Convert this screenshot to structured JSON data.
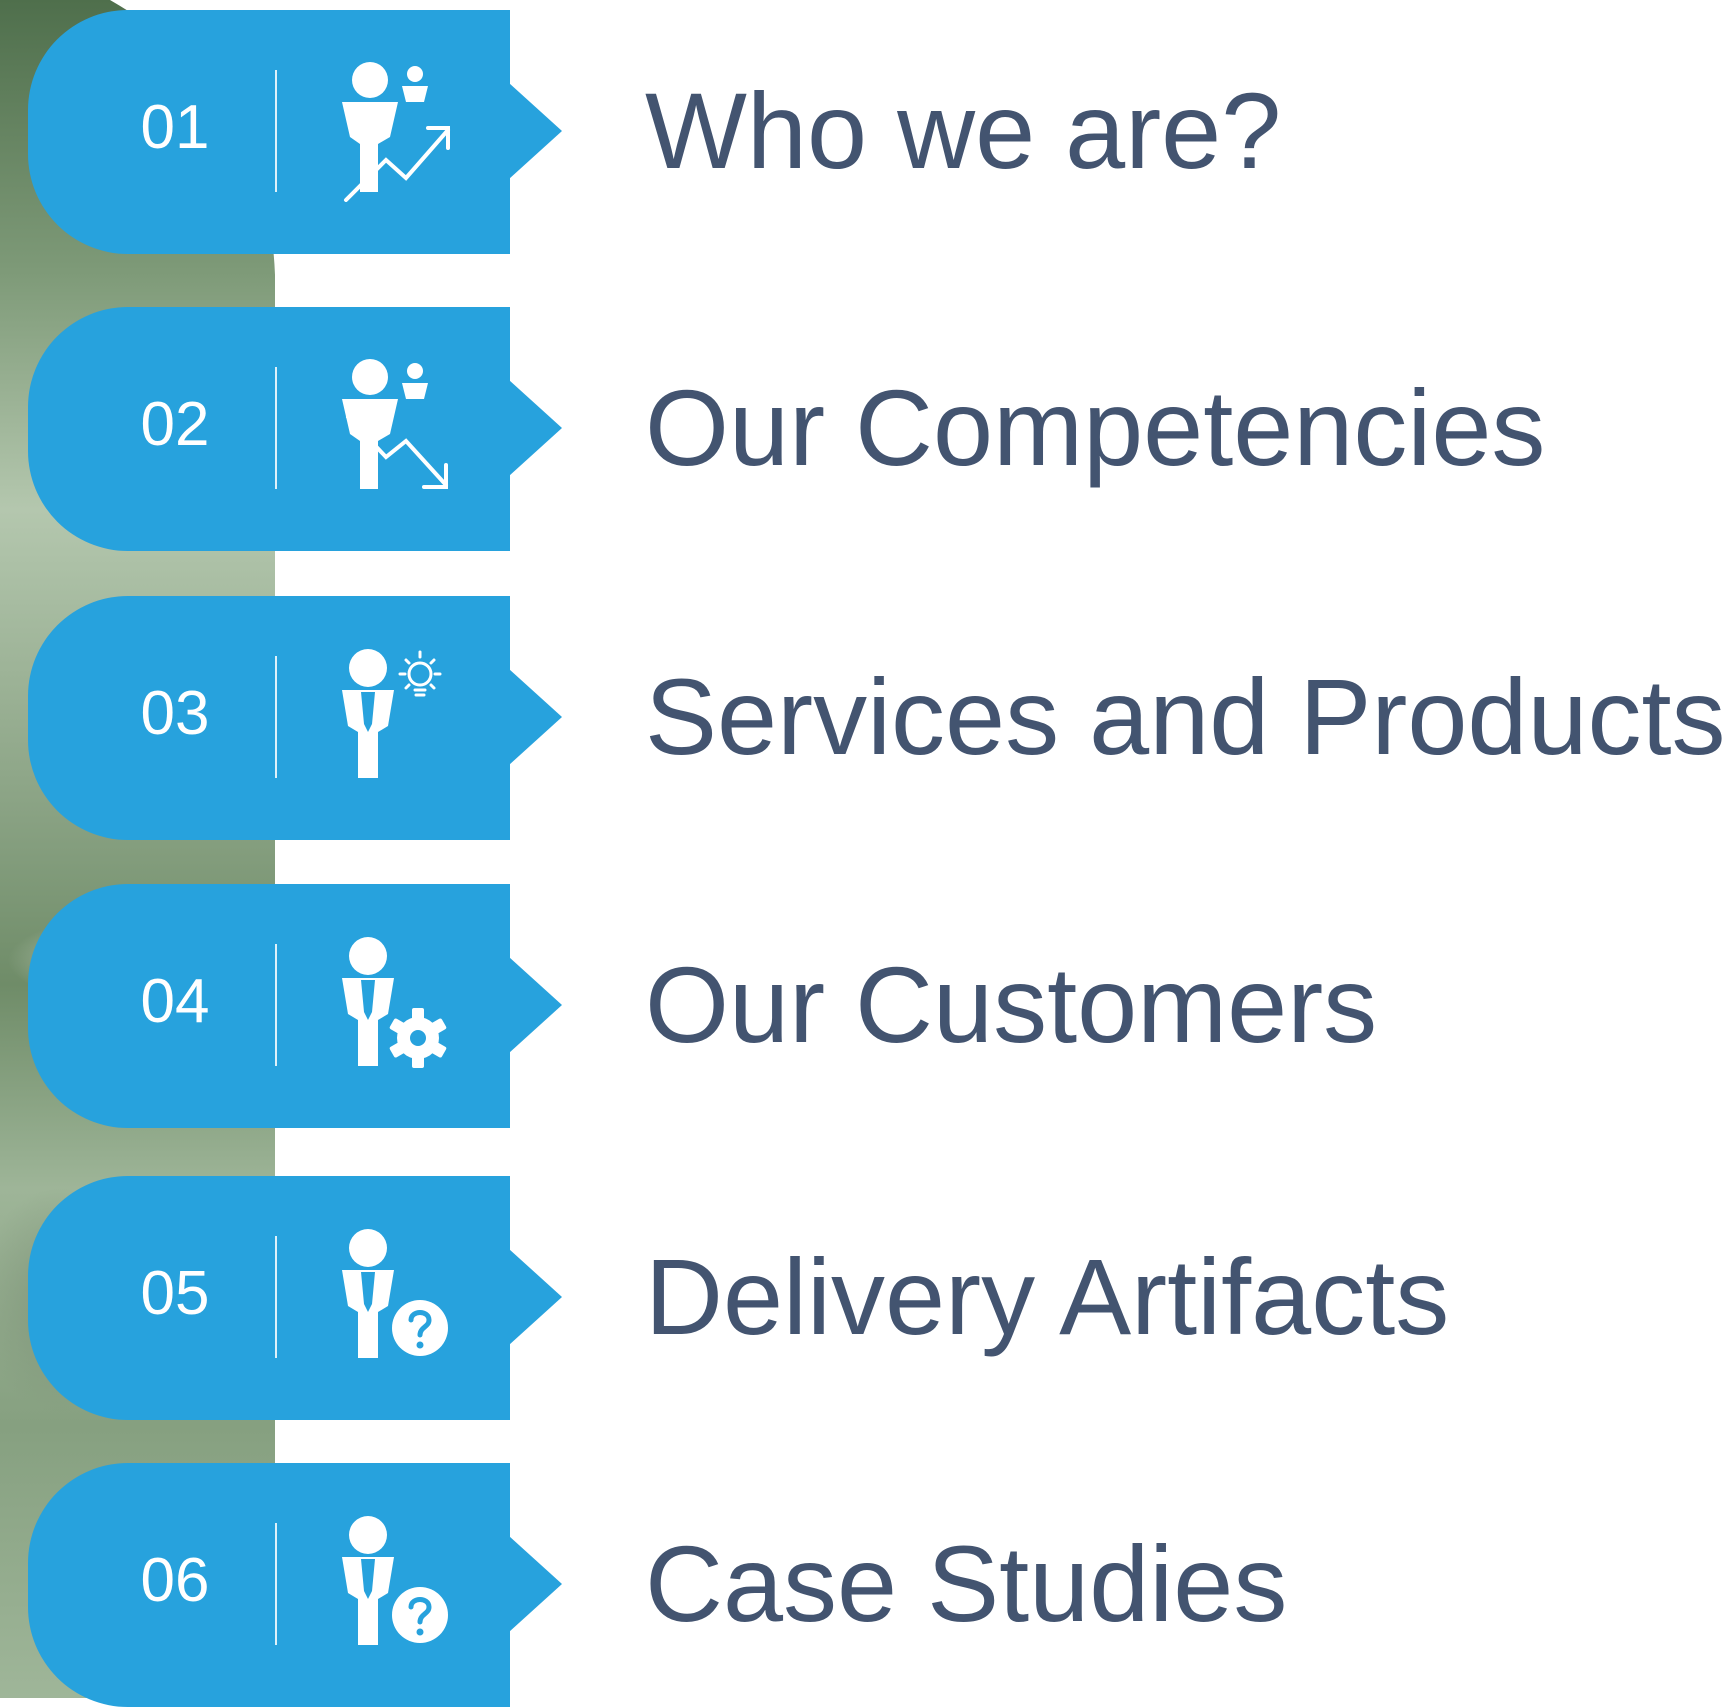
{
  "agenda": {
    "items": [
      {
        "number": "01",
        "label": "Who we are?",
        "icon": "person-chart-up-icon"
      },
      {
        "number": "02",
        "label": "Our Competencies",
        "icon": "person-chart-down-icon"
      },
      {
        "number": "03",
        "label": "Services and Products",
        "icon": "person-lightbulb-icon"
      },
      {
        "number": "04",
        "label": "Our Customers",
        "icon": "person-gear-icon"
      },
      {
        "number": "05",
        "label": "Delivery Artifacts",
        "icon": "person-question-icon"
      },
      {
        "number": "06",
        "label": "Case Studies",
        "icon": "person-question-icon"
      }
    ]
  },
  "colors": {
    "tab": "#27a2dd",
    "label_text": "#435470",
    "icon": "#ffffff"
  }
}
